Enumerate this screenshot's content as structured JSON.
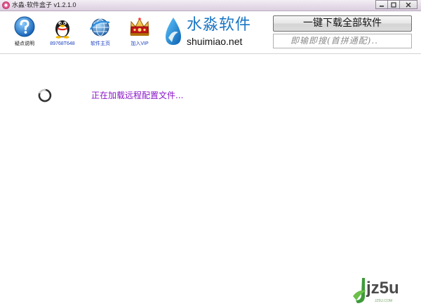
{
  "window": {
    "title": "水淼·软件盒子 v1.2.1.0",
    "controls": [
      "minimize",
      "maximize",
      "close"
    ]
  },
  "toolbar": {
    "items": [
      {
        "label": "疑点说明",
        "icon": "help-icon",
        "color": "#111111"
      },
      {
        "label": "89768T648",
        "icon": "qq-penguin-icon",
        "color": "#1a3fbf"
      },
      {
        "label": "软件主页",
        "icon": "globe-icon",
        "color": "#1a3fbf"
      },
      {
        "label": "加入VIP",
        "icon": "vip-crown-icon",
        "color": "#1a3fbf"
      }
    ]
  },
  "logo": {
    "cn": "水淼软件",
    "en": "shuimiao.net",
    "brand_color": "#1a76c4"
  },
  "download_button": {
    "label": "一键下载全部软件"
  },
  "search": {
    "placeholder": "即输即搜(首拼通配).."
  },
  "status": {
    "text": "正在加载远程配置文件...",
    "color": "#8a16c8"
  },
  "watermark": {
    "text": "jz5u",
    "small": "JZ5U.COM"
  }
}
